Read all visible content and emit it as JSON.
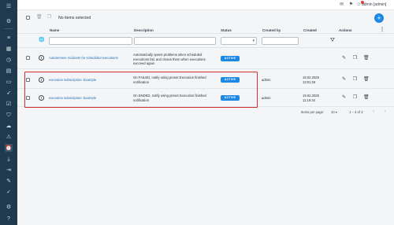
{
  "topbar": {
    "user_label": "admin [admin]",
    "icons": [
      "chat-icon",
      "bookmark-icon",
      "user-icon"
    ]
  },
  "toolbar": {
    "selection_text": "No items selected",
    "add_button_label": "+"
  },
  "table": {
    "columns": [
      "Name",
      "Description",
      "Status",
      "Created by",
      "Created",
      "Actions"
    ],
    "status_filter_value": "",
    "rows": [
      {
        "name": "Autoremove incidents for scheduled executions",
        "description": [
          "Automatically opens problems when scheduled",
          "executions fail, and closes them when executions",
          "succeed again"
        ],
        "status": "ACTIVE",
        "created_by": "",
        "created": [
          "",
          ""
        ]
      },
      {
        "name": "execution subscription: Example",
        "description": [
          "On FAILED, notify using preset Execution finished",
          "notification"
        ],
        "status": "ACTIVE",
        "created_by": "admin",
        "created": [
          "18.02.2025",
          "13:01:26"
        ]
      },
      {
        "name": "execution subscription: Example",
        "description": [
          "On ENDED, notify using preset Execution finished",
          "notification"
        ],
        "status": "ACTIVE",
        "created_by": "admin",
        "created": [
          "19.02.2025",
          "11:19:34"
        ]
      }
    ]
  },
  "pagination": {
    "items_per_page_label": "Items per page:",
    "items_per_page_value": "10",
    "range_text": "1 – 3 of 3"
  },
  "colors": {
    "sidebar_bg": "#1f3a4f",
    "accent": "#1e88e5",
    "highlight": "#d32f2f"
  }
}
